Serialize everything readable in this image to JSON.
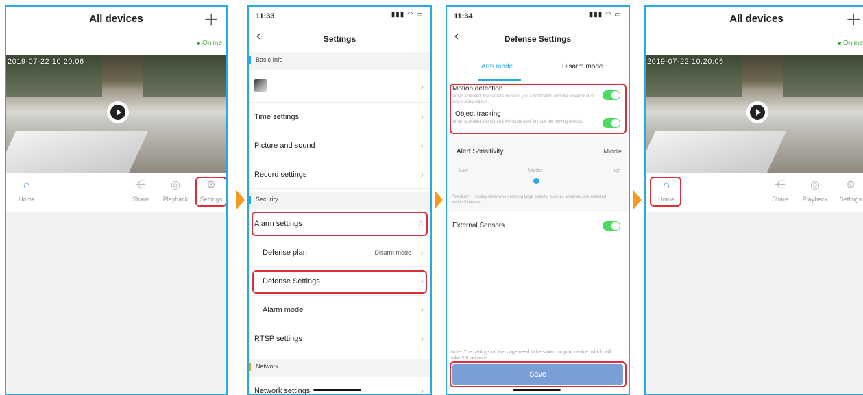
{
  "home": {
    "title": "All devices",
    "status": "Online",
    "timestamp": "2019-07-22  10:20:06",
    "tabs": [
      {
        "label": "Home",
        "icon": "home-icon"
      },
      {
        "label": "Share",
        "icon": "share-icon"
      },
      {
        "label": "Playback",
        "icon": "playback-icon"
      },
      {
        "label": "Settings",
        "icon": "gear-icon"
      }
    ]
  },
  "settings": {
    "time": "11:33",
    "title": "Settings",
    "section_basic": "Basic Info",
    "items_basic": [
      "Time settings",
      "Picture and sound",
      "Record settings"
    ],
    "section_security": "Security",
    "alarm_settings": "Alarm settings",
    "defense_plan": "Defense plan",
    "defense_plan_value": "Disarm mode",
    "defense_settings": "Defense Settings",
    "alarm_mode": "Alarm mode",
    "rtsp": "RTSP settings",
    "section_network": "Network",
    "network_settings": "Network settings"
  },
  "defense": {
    "time": "11:34",
    "title": "Defense Settings",
    "tab_arm": "Arm mode",
    "tab_disarm": "Disarm mode",
    "motion_label": "Motion detection",
    "motion_desc": "When activated, the camera will send you a notification with the screenshot of any moving objects.",
    "tracking_label": "Object tracking",
    "tracking_desc": "When activated, the camera will rotate itself to trace the moving objects.",
    "sensitivity_label": "Alert Sensitivity",
    "sensitivity_value": "Middle",
    "sens_low": "Low",
    "sens_mid": "Middle",
    "sens_high": "High",
    "sensitivity_note": "\"Medium\" - issuing alerts when moving large objects, such as a human, are detected within 5 meters.",
    "external_label": "External Sensors",
    "note": "Note: The settings on this page need to be saved on your device, which will take 3-5 seconds.",
    "save": "Save"
  },
  "colors": {
    "accent": "#29a9e1",
    "highlight": "#d9303a",
    "arrow": "#f39a21",
    "toggle": "#4cd964"
  }
}
